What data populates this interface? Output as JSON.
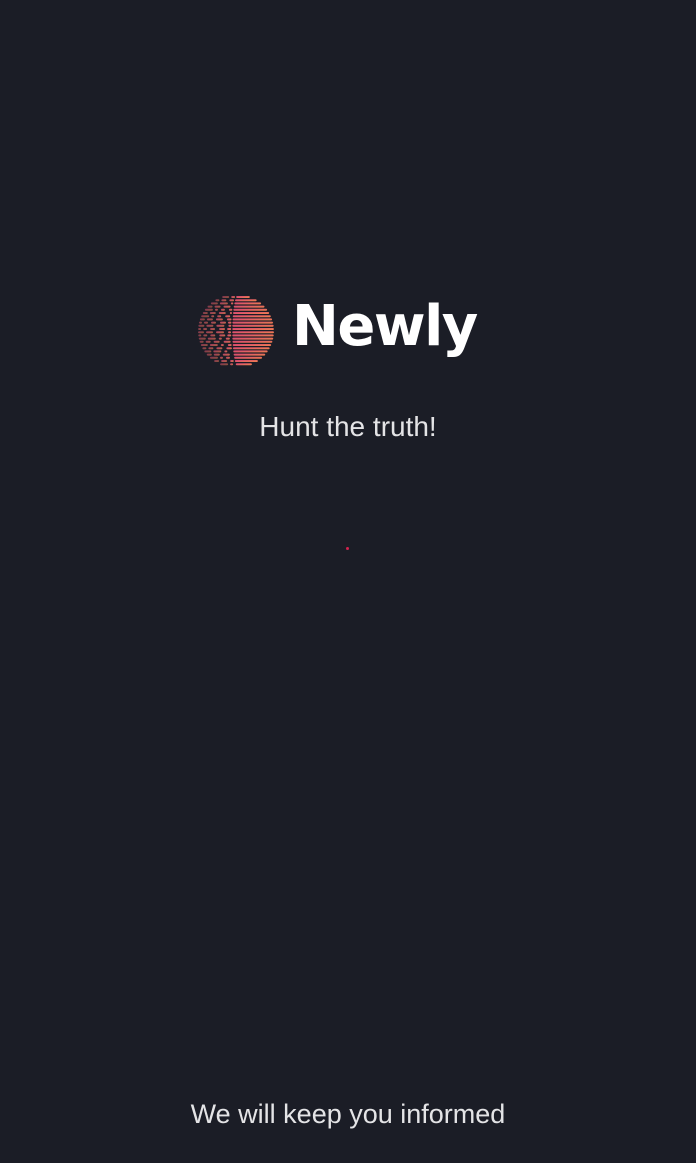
{
  "splash": {
    "logo": {
      "icon": "striped-globe-logo-icon",
      "brand_name": "Newly",
      "gradient_colors": [
        "#d94a73",
        "#ef7f4c"
      ]
    },
    "tagline": "Hunt the truth!",
    "loader": {
      "icon": "loading-dot-icon",
      "color": "#d2234e"
    },
    "footer_text": "We will keep you informed"
  },
  "theme": {
    "background": "#1b1d26",
    "text_primary": "#ffffff",
    "text_secondary": "#e4e4e6"
  }
}
